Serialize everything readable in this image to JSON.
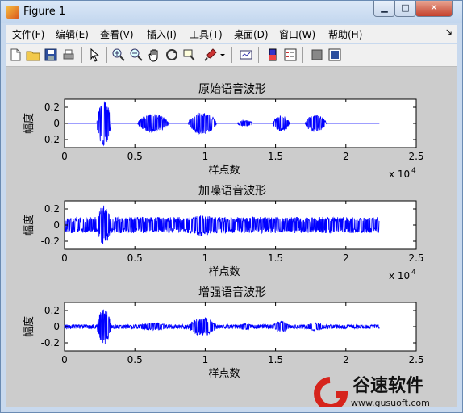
{
  "window": {
    "title": "Figure 1",
    "controls": [
      "0",
      "1",
      "r"
    ]
  },
  "menubar": {
    "items": [
      "文件(F)",
      "编辑(E)",
      "查看(V)",
      "插入(I)",
      "工具(T)",
      "桌面(D)",
      "窗口(W)",
      "帮助(H)"
    ],
    "overflow_arrow": "↘"
  },
  "toolbar": {
    "icons": [
      "new-figure-icon",
      "open-file-icon",
      "save-icon",
      "print-icon",
      "pointer-icon",
      "zoom-in-icon",
      "zoom-out-icon",
      "pan-hand-icon",
      "rotate-3d-icon",
      "data-cursor-icon",
      "brush-icon",
      "brush-dropdown-icon",
      "link-plot-icon",
      "colorbar-icon",
      "legend-icon",
      "hide-plot-tools-icon",
      "show-plot-tools-icon"
    ]
  },
  "colors": {
    "signal": "#0000ff",
    "figure_bg": "#cccccc",
    "axes_bg": "#ffffff"
  },
  "chart_data": [
    {
      "type": "line",
      "title": "原始语音波形",
      "xlabel": "样点数",
      "ylabel": "幅度",
      "xlim": [
        0,
        25000
      ],
      "ylim": [
        -0.3,
        0.3
      ],
      "xticks": [
        "0",
        "0.5",
        "1",
        "1.5",
        "2",
        "2.5"
      ],
      "yticks": [
        "0.2",
        "0",
        "-0.2"
      ],
      "exponent_label": "x 10",
      "exponent": "4",
      "segments": [
        {
          "start": 2300,
          "end": 3300,
          "amp": 0.28
        },
        {
          "start": 5200,
          "end": 7400,
          "amp": 0.12
        },
        {
          "start": 8800,
          "end": 10800,
          "amp": 0.14
        },
        {
          "start": 12300,
          "end": 13400,
          "amp": 0.04
        },
        {
          "start": 14800,
          "end": 16000,
          "amp": 0.1
        },
        {
          "start": 17100,
          "end": 18600,
          "amp": 0.11
        }
      ],
      "noise_level": 0.0,
      "n_samples": 22400
    },
    {
      "type": "line",
      "title": "加噪语音波形",
      "xlabel": "样点数",
      "ylabel": "幅度",
      "xlim": [
        0,
        25000
      ],
      "ylim": [
        -0.3,
        0.3
      ],
      "xticks": [
        "0",
        "0.5",
        "1",
        "1.5",
        "2",
        "2.5"
      ],
      "yticks": [
        "0.2",
        "0",
        "-0.2"
      ],
      "exponent_label": "x 10",
      "exponent": "4",
      "segments": [
        {
          "start": 2300,
          "end": 3300,
          "amp": 0.25
        },
        {
          "start": 5200,
          "end": 7400,
          "amp": 0.08
        },
        {
          "start": 8800,
          "end": 10800,
          "amp": 0.14
        },
        {
          "start": 12300,
          "end": 13400,
          "amp": 0.03
        },
        {
          "start": 14800,
          "end": 16000,
          "amp": 0.06
        },
        {
          "start": 17100,
          "end": 18600,
          "amp": 0.06
        }
      ],
      "noise_level": 0.1,
      "n_samples": 22400
    },
    {
      "type": "line",
      "title": "增强语音波形",
      "xlabel": "样点数",
      "ylabel": "幅度",
      "xlim": [
        0,
        25000
      ],
      "ylim": [
        -0.3,
        0.3
      ],
      "xticks": [
        "0",
        "0.5",
        "1",
        "1.5",
        "2",
        "2.5"
      ],
      "yticks": [
        "0.2",
        "0",
        "-0.2"
      ],
      "exponent_label": "",
      "exponent": "",
      "segments": [
        {
          "start": 2300,
          "end": 3300,
          "amp": 0.22
        },
        {
          "start": 5200,
          "end": 7400,
          "amp": 0.05
        },
        {
          "start": 8800,
          "end": 10800,
          "amp": 0.12
        },
        {
          "start": 12300,
          "end": 13400,
          "amp": 0.04
        },
        {
          "start": 14800,
          "end": 16000,
          "amp": 0.07
        },
        {
          "start": 17100,
          "end": 18600,
          "amp": 0.05
        }
      ],
      "noise_level": 0.025,
      "n_samples": 22400
    }
  ],
  "watermark": {
    "brand": "谷速软件",
    "url": "www.gusuoft.com"
  }
}
